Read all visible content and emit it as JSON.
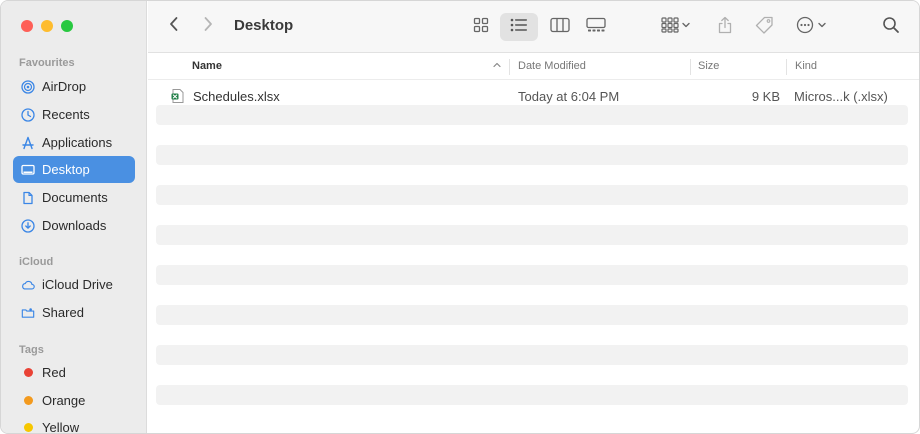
{
  "window": {
    "title": "Desktop"
  },
  "sidebar": {
    "sections": [
      {
        "title": "Favourites",
        "items": [
          {
            "label": "AirDrop",
            "icon": "airdrop-icon"
          },
          {
            "label": "Recents",
            "icon": "clock-icon"
          },
          {
            "label": "Applications",
            "icon": "applications-icon"
          },
          {
            "label": "Desktop",
            "icon": "desktop-icon",
            "selected": true
          },
          {
            "label": "Documents",
            "icon": "document-icon"
          },
          {
            "label": "Downloads",
            "icon": "download-icon"
          }
        ]
      },
      {
        "title": "iCloud",
        "items": [
          {
            "label": "iCloud Drive",
            "icon": "cloud-icon"
          },
          {
            "label": "Shared",
            "icon": "shared-folder-icon"
          }
        ]
      },
      {
        "title": "Tags",
        "items": [
          {
            "label": "Red",
            "color": "#e94235"
          },
          {
            "label": "Orange",
            "color": "#f39a1e"
          },
          {
            "label": "Yellow",
            "color": "#f6c700"
          }
        ]
      }
    ]
  },
  "toolbar": {
    "back_icon": "chevron-left-icon",
    "forward_icon": "chevron-right-icon",
    "view_icons": [
      "icon-view-icon",
      "list-view-icon",
      "column-view-icon",
      "gallery-view-icon"
    ],
    "active_view": "list-view-icon",
    "group_icon": "group-icon",
    "share_icon": "share-icon",
    "tag_icon": "tag-icon",
    "more_icon": "more-icon",
    "search_icon": "search-icon"
  },
  "columns": {
    "name": "Name",
    "date": "Date Modified",
    "size": "Size",
    "kind": "Kind"
  },
  "files": [
    {
      "name": "Schedules.xlsx",
      "date": "Today at 6:04 PM",
      "size": "9 KB",
      "kind": "Micros...k (.xlsx)"
    }
  ],
  "colors": {
    "selection": "#4a90e2",
    "accent": "#3a86e6"
  }
}
